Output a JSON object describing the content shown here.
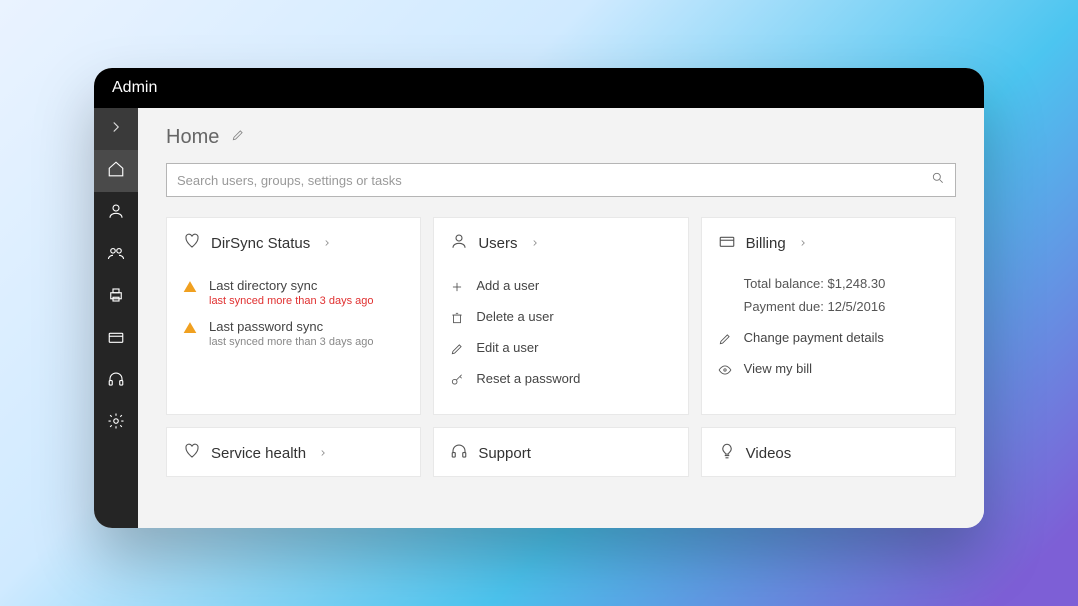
{
  "titlebar": "Admin",
  "page": {
    "title": "Home"
  },
  "search": {
    "placeholder": "Search users, groups, settings or tasks"
  },
  "cards": {
    "dirsync": {
      "title": "DirSync Status",
      "items": [
        {
          "label": "Last directory sync",
          "sub": "last synced more than 3 days ago",
          "error": true
        },
        {
          "label": "Last password sync",
          "sub": "last synced more than 3 days ago",
          "error": false
        }
      ]
    },
    "users": {
      "title": "Users",
      "items": [
        {
          "label": "Add a user"
        },
        {
          "label": "Delete a user"
        },
        {
          "label": "Edit a user"
        },
        {
          "label": "Reset a password"
        }
      ]
    },
    "billing": {
      "title": "Billing",
      "info": {
        "balance_label": "Total balance: $1,248.30",
        "due_label": "Payment due: 12/5/2016"
      },
      "items": [
        {
          "label": "Change payment details"
        },
        {
          "label": "View my bill"
        }
      ]
    },
    "service_health": {
      "title": "Service health"
    },
    "support": {
      "title": "Support"
    },
    "videos": {
      "title": "Videos"
    }
  }
}
